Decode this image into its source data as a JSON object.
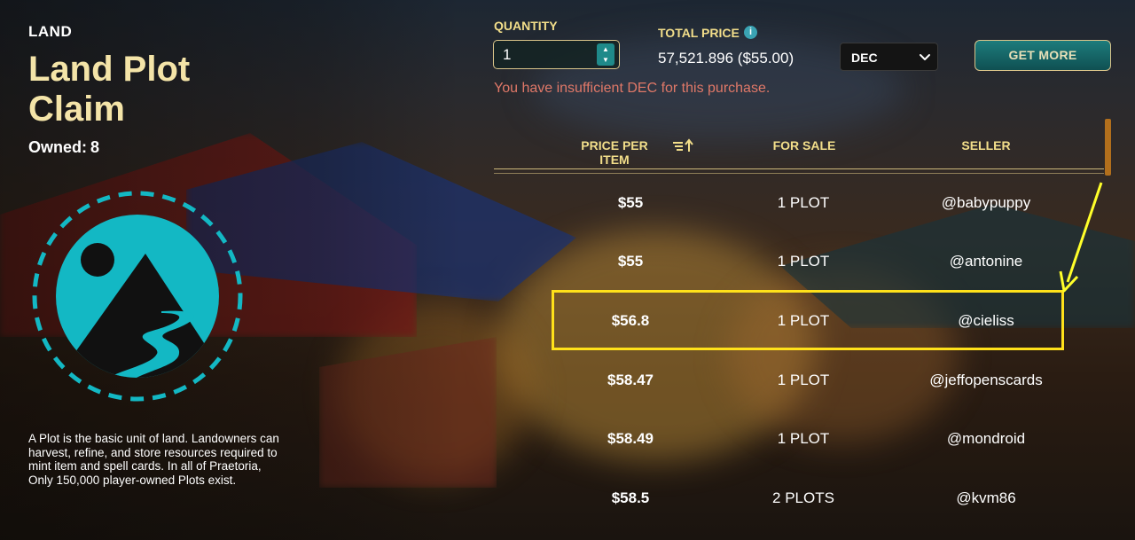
{
  "land": {
    "category": "LAND",
    "title": "Land Plot Claim",
    "owned_label": "Owned:",
    "owned_count": "8",
    "description": "A Plot is the basic unit of land. Landowners can harvest, refine, and store resources required to mint item and spell cards. In all of Praetoria, Only 150,000 player-owned Plots exist."
  },
  "purchase": {
    "quantity_label": "QUANTITY",
    "quantity_value": "1",
    "total_price_label": "TOTAL PRICE",
    "total_price_value": "57,521.896 ($55.00)",
    "currency_selected": "DEC",
    "get_more_label": "GET MORE",
    "warning": "You have insufficient DEC for this purchase."
  },
  "table": {
    "columns": [
      "PRICE PER ITEM",
      "FOR SALE",
      "SELLER"
    ],
    "rows": [
      {
        "price": "$55",
        "for_sale": "1 PLOT",
        "seller": "@babypuppy"
      },
      {
        "price": "$55",
        "for_sale": "1 PLOT",
        "seller": "@antonine"
      },
      {
        "price": "$56.8",
        "for_sale": "1 PLOT",
        "seller": "@cieliss"
      },
      {
        "price": "$58.47",
        "for_sale": "1 PLOT",
        "seller": "@jeffopenscards"
      },
      {
        "price": "$58.49",
        "for_sale": "1 PLOT",
        "seller": "@mondroid"
      },
      {
        "price": "$58.5",
        "for_sale": "2 PLOTS",
        "seller": "@kvm86"
      }
    ]
  },
  "icons": {
    "info": "info-icon",
    "sort": "sort-ascending-icon",
    "chevron": "chevron-down-icon",
    "logo": "land-plot-logo"
  },
  "colors": {
    "gold": "#f2de8a",
    "title": "#f4e4a8",
    "teal": "#13b8c4",
    "warning": "#e07868",
    "highlight": "#ffe11a"
  }
}
